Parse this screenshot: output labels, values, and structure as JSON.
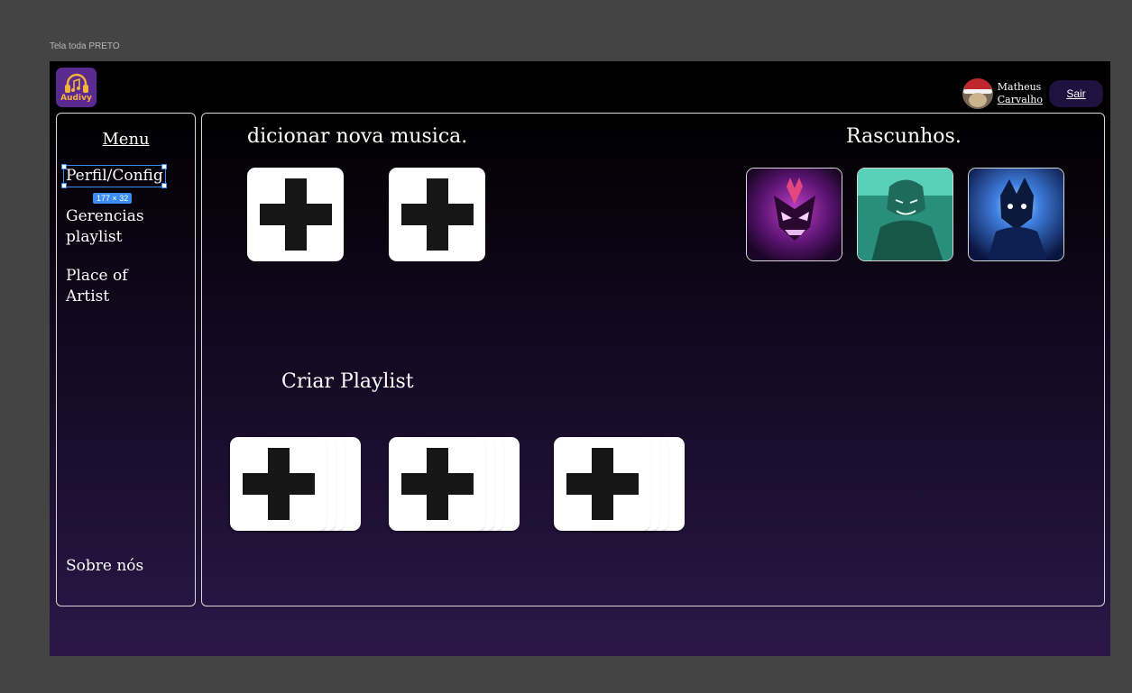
{
  "canvas": {
    "frame_label": "Tela toda PRETO"
  },
  "brand": {
    "logo_text": "Audivy",
    "logo_icon": "headphones-music-icon"
  },
  "user": {
    "first_name": "Matheus",
    "last_name": "Carvalho",
    "logout_label": "Sair"
  },
  "sidebar": {
    "title": "Menu",
    "items": [
      {
        "label": "Perfil/Config"
      },
      {
        "label": "Gerencias",
        "label2": "playlist"
      },
      {
        "label": "Place of",
        "label2": "Artist"
      }
    ],
    "footer": "Sobre nós",
    "selection_badge": "177 × 32"
  },
  "main": {
    "add_music_heading": "dicionar nova musica.",
    "drafts_heading": "Rascunhos.",
    "create_playlist_heading": "Criar Playlist"
  },
  "colors": {
    "accent_purple": "#5b2a91",
    "logo_orange": "#f4b13c",
    "selection_blue": "#3b8df5",
    "logout_bg": "#1f1140"
  }
}
